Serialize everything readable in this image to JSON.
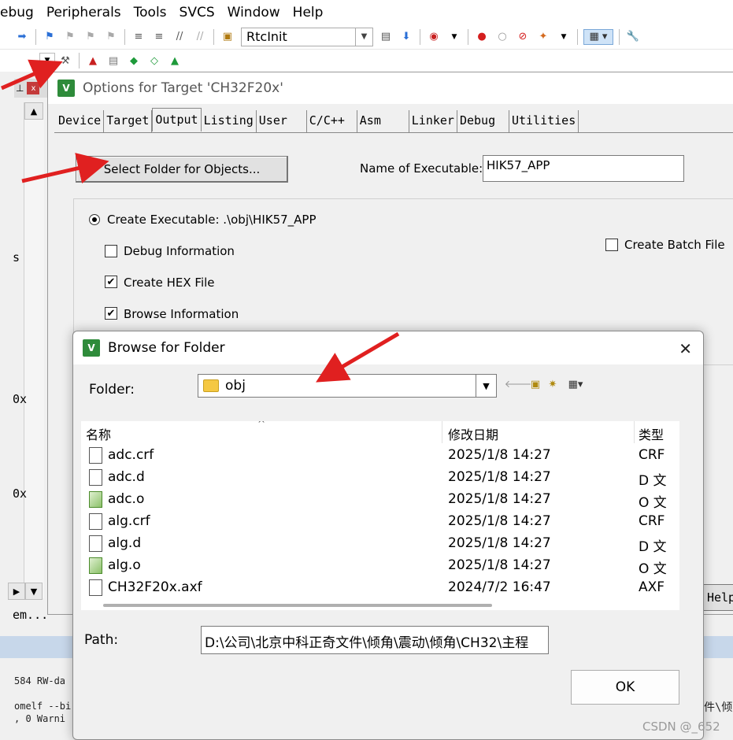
{
  "menu": [
    "ebug",
    "Peripherals",
    "Tools",
    "SVCS",
    "Window",
    "Help"
  ],
  "toolbar": {
    "target_combo": "RtcInit"
  },
  "left_pane": {
    "labels": [
      "s",
      "0x",
      "0x"
    ],
    "bottom_text": "em...",
    "pin_glyph": "⊥",
    "close_glyph": "x"
  },
  "log": {
    "lines": [
      "584 RW-da",
      "omelf --bi",
      ", 0 Warni"
    ],
    "right_text": "件\\倾"
  },
  "options_dialog": {
    "title": "Options for Target 'CH32F20x'",
    "tabs": [
      "Device",
      "Target",
      "Output",
      "Listing",
      "User",
      "C/C++",
      "Asm",
      "Linker",
      "Debug",
      "Utilities"
    ],
    "active_tab": "Output",
    "select_folder_button": "Select Folder for Objects...",
    "name_of_executable_label": "Name of Executable:",
    "name_of_executable_value": "HIK57_APP",
    "create_executable_label": "Create Executable:  .\\obj\\HIK57_APP",
    "debug_information_label": "Debug Information",
    "debug_information_checked": false,
    "create_hex_label": "Create HEX File",
    "create_hex_checked": true,
    "browse_information_label": "Browse Information",
    "browse_information_checked": true,
    "create_batch_label": "Create Batch File",
    "create_batch_checked": false,
    "help_button": "Help"
  },
  "browse_dialog": {
    "title": "Browse for Folder",
    "folder_label": "Folder:",
    "folder_value": "obj",
    "columns": {
      "name": "名称",
      "modified": "修改日期",
      "type": "类型"
    },
    "files": [
      {
        "name": "adc.crf",
        "date": "2025/1/8 14:27",
        "type": "CRF",
        "icon": "file"
      },
      {
        "name": "adc.d",
        "date": "2025/1/8 14:27",
        "type": "D 文",
        "icon": "file"
      },
      {
        "name": "adc.o",
        "date": "2025/1/8 14:27",
        "type": "O 文",
        "icon": "object"
      },
      {
        "name": "alg.crf",
        "date": "2025/1/8 14:27",
        "type": "CRF",
        "icon": "file"
      },
      {
        "name": "alg.d",
        "date": "2025/1/8 14:27",
        "type": "D 文",
        "icon": "file"
      },
      {
        "name": "alg.o",
        "date": "2025/1/8 14:27",
        "type": "O 文",
        "icon": "object"
      },
      {
        "name": "CH32F20x.axf",
        "date": "2024/7/2 16:47",
        "type": "AXF",
        "icon": "file"
      }
    ],
    "path_label": "Path:",
    "path_value": "D:\\公司\\北京中科正奇文件\\倾角\\震动\\倾角\\CH32\\主程",
    "ok_button": "OK",
    "close_glyph": "✕"
  },
  "watermark": "CSDN @_652",
  "colors": {
    "arrow": "#e02020",
    "accent": "#2e8b3a"
  }
}
